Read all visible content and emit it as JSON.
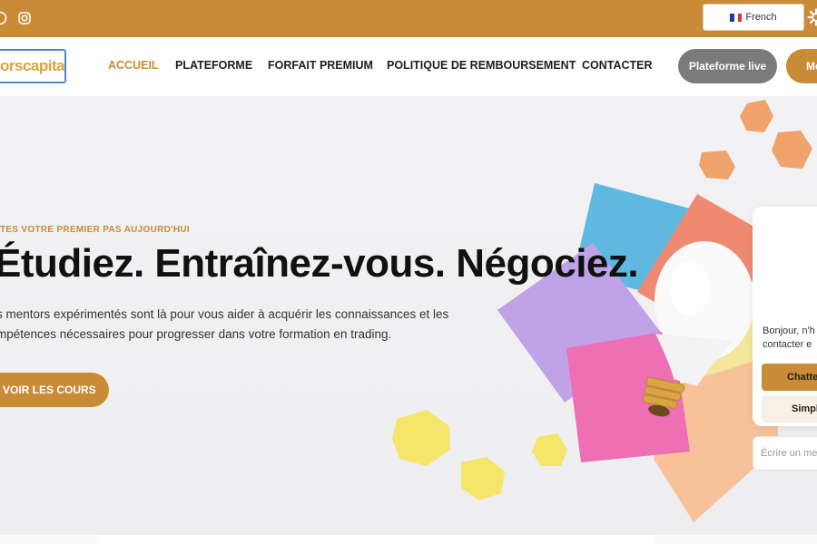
{
  "topbar": {
    "bg_color": "#c98b36",
    "social_icons": [
      "facebook-icon",
      "instagram-icon"
    ],
    "language": {
      "label": "French",
      "flag": "fr-flag"
    },
    "settings_icon": "gear-icon"
  },
  "navbar": {
    "logo_text": "orscapital",
    "items": [
      {
        "label": "ACCUEIL",
        "active": true
      },
      {
        "label": "PLATEFORME",
        "active": false
      },
      {
        "label": "FORFAIT PREMIUM",
        "active": false
      },
      {
        "label": "POLITIQUE DE REMBOURSEMENT",
        "active": false
      },
      {
        "label": "CONTACTER",
        "active": false
      }
    ],
    "live_button": "Plateforme live",
    "member_button": "Me"
  },
  "hero": {
    "eyebrow": "TES VOTRE PREMIER PAS AUJOURD'HUI",
    "headline": "Étudiez. Entraînez-vous. Négociez.",
    "subtitle_line1": "s mentors expérimentés sont là pour vous aider à acquérir les connaissances et les",
    "subtitle_line2": "mpétences nécessaires pour progresser dans votre formation en trading.",
    "cta": "VOIR LES COURS"
  },
  "chat": {
    "message_line1": "Bonjour, n'h",
    "message_line2": "contacter e",
    "primary_button": "Chatte",
    "secondary_button": "Simpl",
    "input_placeholder": "Écrire un me"
  },
  "colors": {
    "accent": "#c98b36",
    "live_button": "#7b7b7b",
    "logo_border": "#4f86d6"
  }
}
